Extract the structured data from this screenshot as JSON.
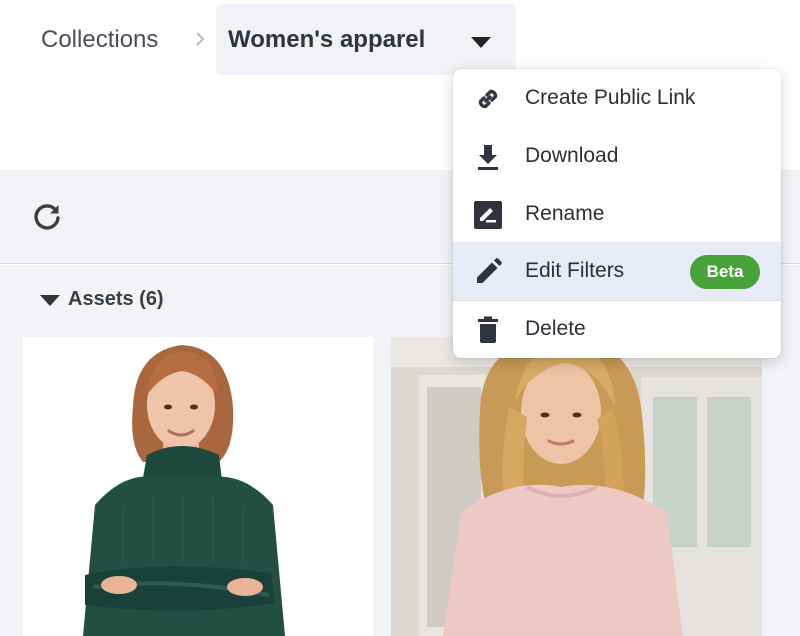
{
  "breadcrumb": {
    "root": "Collections",
    "current": "Women's apparel"
  },
  "assets": {
    "title": "Assets (6)"
  },
  "menu": {
    "items": [
      {
        "label": "Create Public Link",
        "icon": "link-icon"
      },
      {
        "label": "Download",
        "icon": "download-icon"
      },
      {
        "label": "Rename",
        "icon": "rename-icon"
      },
      {
        "label": "Edit Filters",
        "icon": "pencil-icon",
        "badge": "Beta"
      },
      {
        "label": "Delete",
        "icon": "trash-icon"
      }
    ],
    "highlighted_index": 3
  },
  "colors": {
    "accent_badge": "#46a239",
    "menu_highlight": "#e8eaf6",
    "panel_background": "#f2f3f7"
  }
}
